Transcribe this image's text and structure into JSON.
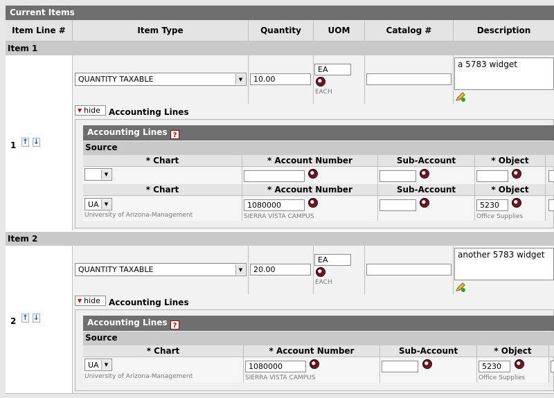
{
  "section_title": "Current Items",
  "columns": {
    "line": "Item Line #",
    "item_type": "Item Type",
    "quantity": "Quantity",
    "uom": "UOM",
    "catalog": "Catalog #",
    "description": "Description"
  },
  "items": [
    {
      "header": "Item 1",
      "line_number": "1",
      "item_type": "QUANTITY TAXABLE",
      "quantity": "10.00",
      "uom": "EA",
      "uom_desc": "EACH",
      "catalog": "",
      "description": "a 5783 widget",
      "hide_label": "hide",
      "accounting_label": "Accounting Lines",
      "accounting": {
        "title": "Accounting Lines",
        "help": "?",
        "source_label": "Source",
        "headers": {
          "chart": "* Chart",
          "account": "* Account Number",
          "sub_account": "Sub-Account",
          "object": "* Object"
        },
        "lines": [
          {
            "chart": "",
            "chart_desc": "",
            "account": "",
            "account_desc": "",
            "sub_account": "",
            "object": "",
            "object_desc": ""
          },
          {
            "chart": "UA",
            "chart_desc": "University of Arizona-Management",
            "account": "1080000",
            "account_desc": "SIERRA VISTA CAMPUS",
            "sub_account": "",
            "object": "5230",
            "object_desc": "Office Supplies"
          }
        ]
      }
    },
    {
      "header": "Item 2",
      "line_number": "2",
      "item_type": "QUANTITY TAXABLE",
      "quantity": "20.00",
      "uom": "EA",
      "uom_desc": "EACH",
      "catalog": "",
      "description": "another 5783 widget",
      "hide_label": "hide",
      "accounting_label": "Accounting Lines",
      "accounting": {
        "title": "Accounting Lines",
        "help": "?",
        "source_label": "Source",
        "headers": {
          "chart": "* Chart",
          "account": "* Account Number",
          "sub_account": "Sub-Account",
          "object": "* Object"
        },
        "lines": [
          {
            "chart": "UA",
            "chart_desc": "University of Arizona-Management",
            "account": "1080000",
            "account_desc": "SIERRA VISTA CAMPUS",
            "sub_account": "",
            "object": "5230",
            "object_desc": "Office Supplies"
          }
        ]
      }
    }
  ],
  "icons": {
    "lookup": "magnifier-lookup-icon",
    "move_up": "up-arrow-icon",
    "move_down": "down-arrow-icon",
    "edit": "pencil-icon",
    "collapse": "triangle-down-icon",
    "help": "question-icon"
  }
}
